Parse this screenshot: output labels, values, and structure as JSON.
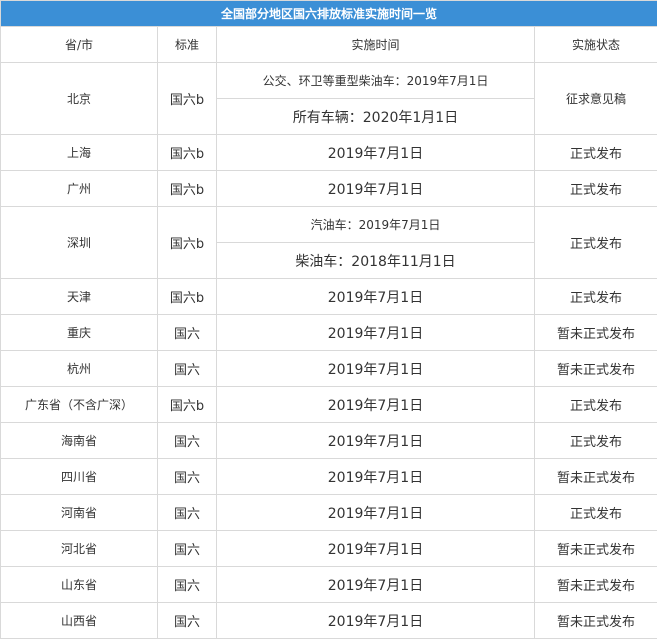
{
  "title": "全国部分地区国六排放标准实施时间一览",
  "headers": [
    "省/市",
    "标准",
    "实施时间",
    "实施状态"
  ],
  "rows": [
    {
      "prov": "北京",
      "std": "国六b",
      "dates": [
        "公交、环卫等重型柴油车：2019年7月1日",
        "所有车辆：2020年1月1日"
      ],
      "status": "征求意见稿"
    },
    {
      "prov": "上海",
      "std": "国六b",
      "dates": [
        "2019年7月1日"
      ],
      "status": "正式发布"
    },
    {
      "prov": "广州",
      "std": "国六b",
      "dates": [
        "2019年7月1日"
      ],
      "status": "正式发布"
    },
    {
      "prov": "深圳",
      "std": "国六b",
      "dates": [
        "汽油车：2019年7月1日",
        "柴油车：2018年11月1日"
      ],
      "status": "正式发布"
    },
    {
      "prov": "天津",
      "std": "国六b",
      "dates": [
        "2019年7月1日"
      ],
      "status": "正式发布"
    },
    {
      "prov": "重庆",
      "std": "国六",
      "dates": [
        "2019年7月1日"
      ],
      "status": "暂未正式发布"
    },
    {
      "prov": "杭州",
      "std": "国六",
      "dates": [
        "2019年7月1日"
      ],
      "status": "暂未正式发布"
    },
    {
      "prov": "广东省（不含广深）",
      "std": "国六b",
      "dates": [
        "2019年7月1日"
      ],
      "status": "正式发布"
    },
    {
      "prov": "海南省",
      "std": "国六",
      "dates": [
        "2019年7月1日"
      ],
      "status": "正式发布"
    },
    {
      "prov": "四川省",
      "std": "国六",
      "dates": [
        "2019年7月1日"
      ],
      "status": "暂未正式发布"
    },
    {
      "prov": "河南省",
      "std": "国六",
      "dates": [
        "2019年7月1日"
      ],
      "status": "正式发布"
    },
    {
      "prov": "河北省",
      "std": "国六",
      "dates": [
        "2019年7月1日"
      ],
      "status": "暂未正式发布"
    },
    {
      "prov": "山东省",
      "std": "国六",
      "dates": [
        "2019年7月1日"
      ],
      "status": "暂未正式发布"
    },
    {
      "prov": "山西省",
      "std": "国六",
      "dates": [
        "2019年7月1日"
      ],
      "status": "暂未正式发布"
    }
  ],
  "colors": {
    "title_bg": "#3b8fd6",
    "title_text": "#ffffff",
    "border": "#d9d9d9",
    "text": "#333333"
  }
}
